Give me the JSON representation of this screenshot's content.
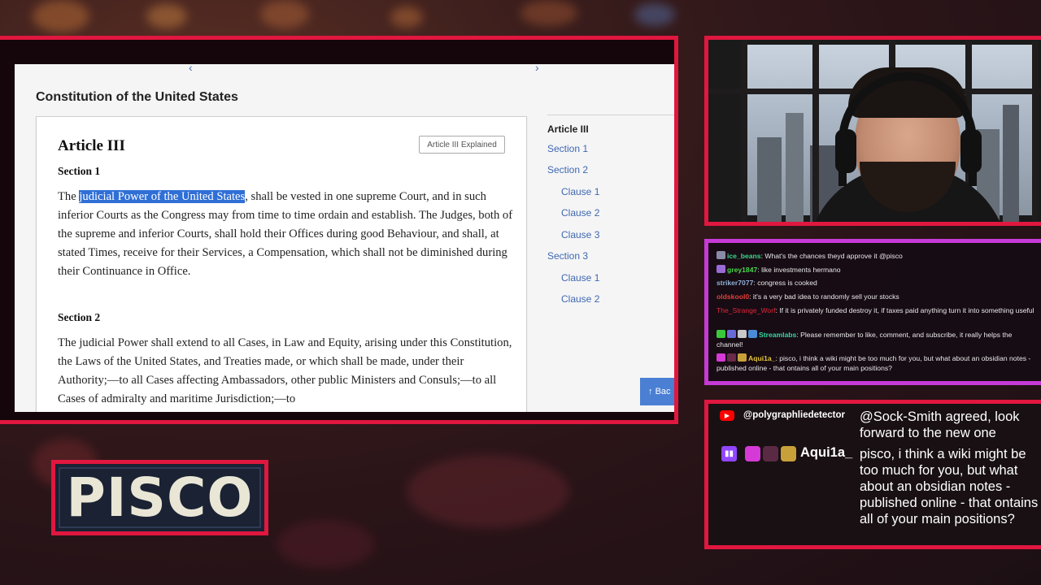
{
  "browser": {
    "doc_title": "Constitution of the United States",
    "article": {
      "heading": "Article III",
      "explained_button": "Article III Explained",
      "sections": [
        {
          "heading": "Section 1",
          "pre": "The ",
          "highlight": "judicial Power of the United States",
          "post": ", shall be vested in one supreme Court, and in such inferior Courts as the Congress may from time to time ordain and establish. The Judges, both of the supreme and inferior Courts, shall hold their Offices during good Behaviour, and shall, at stated Times, receive for their Services, a Compensation, which shall not be diminished during their Continuance in Office."
        },
        {
          "heading": "Section 2",
          "text": "The judicial Power shall extend to all Cases, in Law and Equity, arising under this Constitution, the Laws of the United States, and Treaties made, or which shall be made, under their Authority;—to all Cases affecting Ambassadors, other public Ministers and Consuls;—to all Cases of admiralty and maritime Jurisdiction;—to"
        }
      ]
    },
    "toc": {
      "title": "Article III",
      "items": [
        "Section 1",
        "Section 2",
        "Clause 1",
        "Clause 2",
        "Clause 3",
        "Section 3",
        "Clause 1",
        "Clause 2"
      ]
    },
    "back_button": "Bac",
    "back_icon": "arrow-up-icon"
  },
  "chat": {
    "messages": [
      {
        "user": "ice_beans",
        "user_color": "#3ad68a",
        "text": "What's the chances theyd approve it @pisco"
      },
      {
        "user": "grey1847",
        "user_color": "#49d64a",
        "text": "like investments hermano"
      },
      {
        "user": "striker7077",
        "user_color": "#8fb0d6",
        "text": "congress is cooked"
      },
      {
        "user": "oldskool0",
        "user_color": "#e0403a",
        "text": "it's a very bad idea to randomly sell your stocks"
      },
      {
        "user": "The_Strange_Worf",
        "user_color": "#e0263a",
        "text": "If it is privately funded destroy it, if taxes paid anything turn it into something useful"
      },
      {
        "user": "Streamlabs",
        "user_color": "#36d6a0",
        "text": "Please remember to like, comment, and subscribe, it really helps the channel!"
      },
      {
        "user": "Aqui1a_",
        "user_color": "#e6c63a",
        "text": "pisco, i think a wiki might be too much for you, but what about an obsidian notes - published online - that ontains all of your main positions?"
      }
    ]
  },
  "highlight": {
    "yt_user": "@polygraphliedetector",
    "yt_message": "@Sock-Smith agreed, look forward to the new one",
    "tw_user": "Aqui1a_",
    "tw_message": "pisco, i think a wiki might be too much for you, but what about an obsidian notes - published online - that ontains all of your main positions?"
  },
  "logo": {
    "text": "PISCO"
  },
  "colors": {
    "frame_red": "#e0173f",
    "chat_border": "#c63ad6",
    "link_blue": "#3f68b0",
    "selection": "#2f6fd6"
  }
}
